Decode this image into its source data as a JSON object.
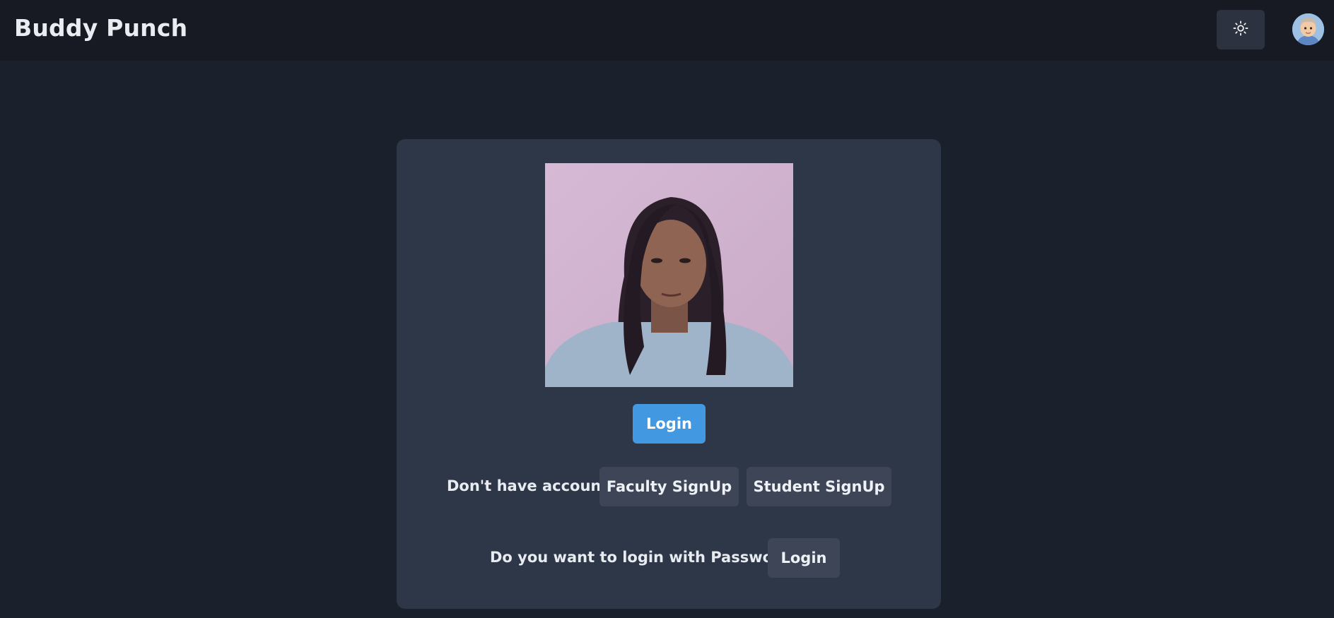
{
  "app": {
    "brand": "Buddy Punch"
  },
  "header": {
    "theme_toggle_icon": "sun-icon",
    "avatar_icon": "user-avatar"
  },
  "login_card": {
    "camera_feed": "webcam-preview",
    "login_label": "Login",
    "no_account_text": "Don't have account?",
    "faculty_signup_label": "Faculty SignUp",
    "student_signup_label": "Student SignUp",
    "password_prompt_text": "Do you want to login with Password ?",
    "password_login_label": "Login"
  },
  "colors": {
    "page_bg": "#1a202c",
    "navbar_bg": "#171923",
    "card_bg": "#2d3748",
    "primary": "#4299e1",
    "secondary_button": "#3d4556"
  }
}
